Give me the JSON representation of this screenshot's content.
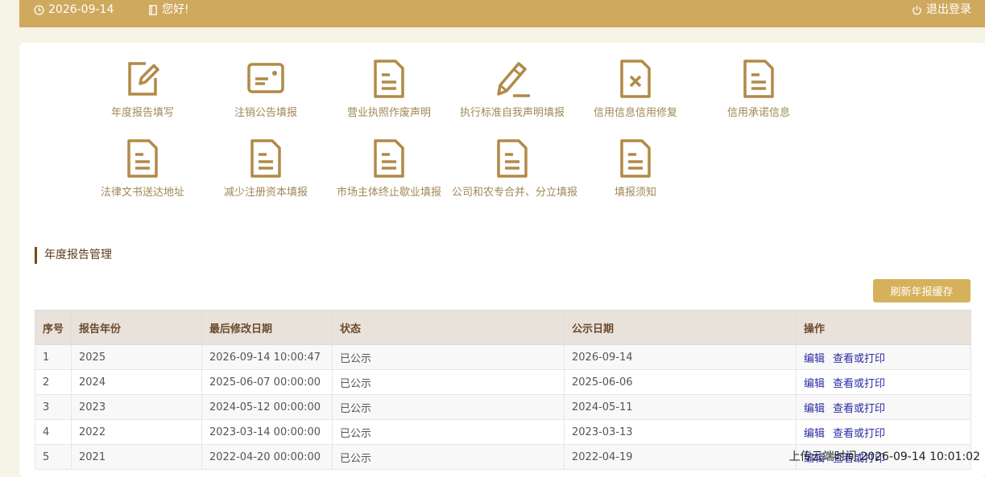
{
  "topbar": {
    "date": "2026-09-14",
    "greeting": "您好!",
    "logout_label": "退出登录"
  },
  "functions_row1": [
    {
      "label": "年度报告填写",
      "icon": "edit-icon"
    },
    {
      "label": "注销公告填报",
      "icon": "card-icon"
    },
    {
      "label": "营业执照作废声明",
      "icon": "document-icon"
    },
    {
      "label": "执行标准自我声明填报",
      "icon": "pencil-icon"
    },
    {
      "label": "信用信息信用修复",
      "icon": "document-x-icon"
    },
    {
      "label": "信用承诺信息",
      "icon": "document-icon"
    }
  ],
  "functions_row2": [
    {
      "label": "法律文书送达地址",
      "icon": "document-icon"
    },
    {
      "label": "减少注册资本填报",
      "icon": "document-icon"
    },
    {
      "label": "市场主体终止歇业填报",
      "icon": "document-icon"
    },
    {
      "label": "公司和农专合并、分立填报",
      "icon": "document-icon"
    },
    {
      "label": "填报须知",
      "icon": "document-icon"
    }
  ],
  "section": {
    "title": "年度报告管理",
    "refresh_label": "刷新年报缓存"
  },
  "table": {
    "headers": [
      "序号",
      "报告年份",
      "最后修改日期",
      "状态",
      "公示日期",
      "操作"
    ],
    "rows": [
      {
        "no": "1",
        "year": "2025",
        "modified": "2026-09-14 10:00:47",
        "status": "已公示",
        "publish": "2026-09-14",
        "edit": "编辑",
        "view": "查看或打印"
      },
      {
        "no": "2",
        "year": "2024",
        "modified": "2025-06-07 00:00:00",
        "status": "已公示",
        "publish": "2025-06-06",
        "edit": "编辑",
        "view": "查看或打印"
      },
      {
        "no": "3",
        "year": "2023",
        "modified": "2024-05-12 00:00:00",
        "status": "已公示",
        "publish": "2024-05-11",
        "edit": "编辑",
        "view": "查看或打印"
      },
      {
        "no": "4",
        "year": "2022",
        "modified": "2023-03-14 00:00:00",
        "status": "已公示",
        "publish": "2023-03-13",
        "edit": "编辑",
        "view": "查看或打印"
      },
      {
        "no": "5",
        "year": "2021",
        "modified": "2022-04-20 00:00:00",
        "status": "已公示",
        "publish": "2022-04-19",
        "edit": "编辑",
        "view": "查看或打印"
      }
    ]
  },
  "upload_time": "上传云端时间:2026-09-14 10:01:02",
  "colors": {
    "topbar": "#cfa95e",
    "icon": "#b08a47",
    "button": "#d6b15c",
    "link": "#2b2ba6"
  }
}
